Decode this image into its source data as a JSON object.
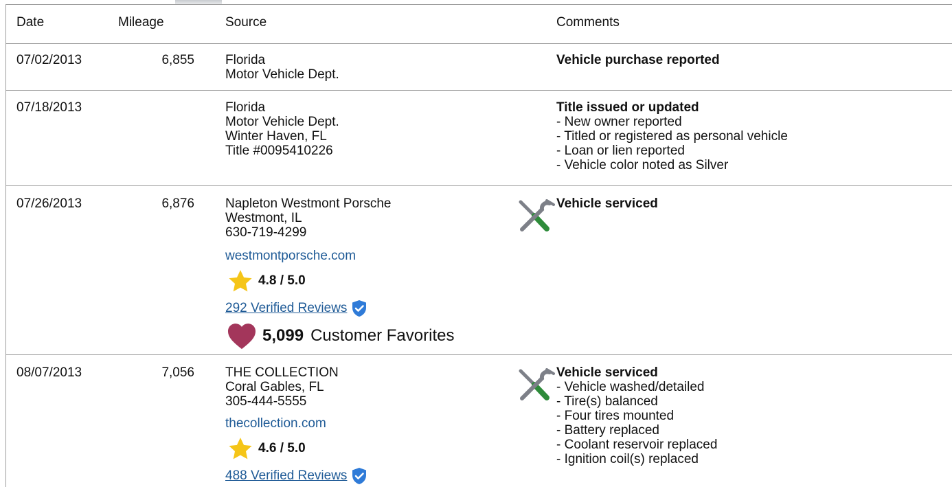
{
  "headers": {
    "date": "Date",
    "mileage": "Mileage",
    "source": "Source",
    "comments": "Comments"
  },
  "records": [
    {
      "date": "07/02/2013",
      "mileage": "6,855",
      "source": [
        "Florida",
        "Motor Vehicle Dept."
      ],
      "comment_title": "Vehicle purchase reported",
      "comment_items": []
    },
    {
      "date": "07/18/2013",
      "mileage": "",
      "source": [
        "Florida",
        "Motor Vehicle Dept.",
        "Winter Haven, FL",
        "Title #0095410226"
      ],
      "comment_title": "Title issued or updated",
      "comment_items": [
        "- New owner reported",
        "- Titled or registered as personal vehicle",
        "- Loan or lien reported",
        "- Vehicle color noted as Silver"
      ]
    },
    {
      "date": "07/26/2013",
      "mileage": "6,876",
      "source": [
        "Napleton Westmont Porsche",
        "Westmont, IL",
        "630-719-4299"
      ],
      "website": "westmontporsche.com",
      "rating": "4.8 / 5.0",
      "reviews": "292 Verified Reviews",
      "favorites_count": "5,099",
      "favorites_label": "Customer Favorites",
      "icon": "service-tools-icon",
      "comment_title": "Vehicle serviced",
      "comment_items": []
    },
    {
      "date": "08/07/2013",
      "mileage": "7,056",
      "source": [
        "THE COLLECTION",
        "Coral Gables, FL",
        "305-444-5555"
      ],
      "website": "thecollection.com",
      "rating": "4.6 / 5.0",
      "reviews": "488 Verified Reviews",
      "icon": "service-tools-icon",
      "comment_title": "Vehicle serviced",
      "comment_items": [
        "- Vehicle washed/detailed",
        "- Tire(s) balanced",
        "- Four tires mounted",
        "- Battery replaced",
        "- Coolant reservoir replaced",
        "- Ignition coil(s) replaced"
      ]
    }
  ],
  "colors": {
    "link": "#1e5a96",
    "star": "#f5c518",
    "shield": "#2f7bd8",
    "heart": "#a3365b",
    "tool_grey": "#7d8088",
    "tool_green": "#2e8b3a"
  }
}
